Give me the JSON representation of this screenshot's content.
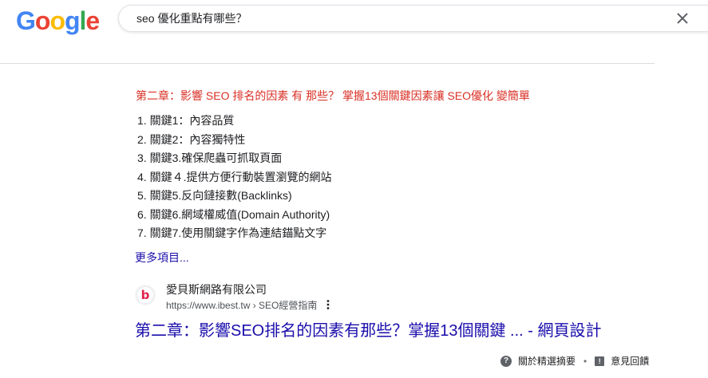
{
  "header": {
    "logo_letters": [
      "G",
      "o",
      "o",
      "g",
      "l",
      "e"
    ],
    "logo_colors": [
      "#4285F4",
      "#EA4335",
      "#FBBC05",
      "#4285F4",
      "#34A853",
      "#EA4335"
    ],
    "search_query": "seo 優化重點有哪些？"
  },
  "snippet": {
    "heading": "第二章：影響 SEO 排名的因素 有 那些？ 掌握13個關鍵因素讓 SEO優化 變簡單",
    "items": [
      "1. 關鍵1：內容品質",
      "2. 關鍵2：內容獨特性",
      "3. 關鍵3.確保爬蟲可抓取頁面",
      "4. 關鍵４.提供方便行動裝置瀏覽的網站",
      "5. 關鍵5.反向鏈接數(Backlinks)",
      "6. 關鍵6.網域權威值(Domain Authority)",
      "7. 關鍵7.使用關鍵字作為連結錨點文字"
    ],
    "more_items": "更多項目..."
  },
  "result": {
    "site_name": "愛貝斯網路有限公司",
    "url": "https://www.ibest.tw › SEO經營指南",
    "title": "第二章：影響SEO排名的因素有那些？掌握13個關鍵 ... - 網頁設計",
    "favicon_letter": "b"
  },
  "footer": {
    "about": "關於精選摘要",
    "separator": "•",
    "feedback": "意見回饋"
  }
}
